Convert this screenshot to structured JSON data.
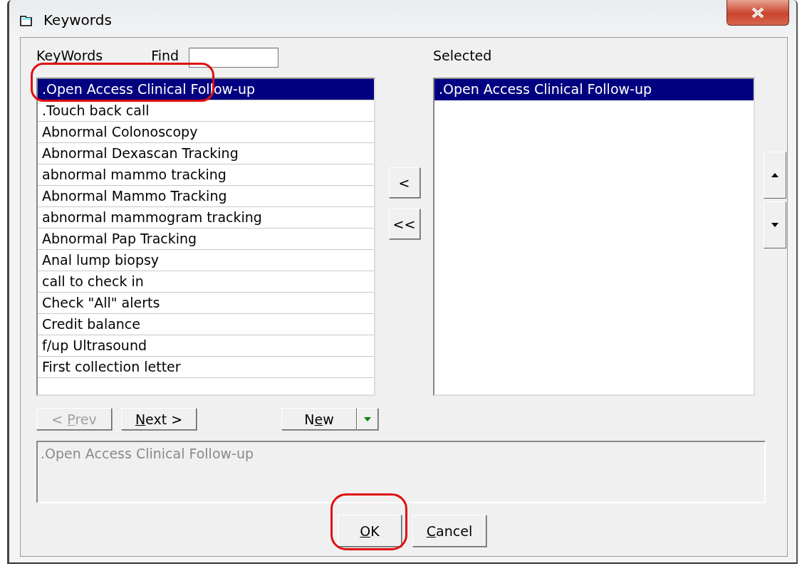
{
  "window": {
    "title": "Keywords"
  },
  "keywords": {
    "label": "KeyWords",
    "find_label": "Find",
    "items": [
      {
        "text": ".Open Access Clinical Follow-up",
        "selected": true,
        "circled": true
      },
      {
        "text": ".Touch back call",
        "selected": false,
        "circled": false
      },
      {
        "text": "Abnormal Colonoscopy",
        "selected": false,
        "circled": false
      },
      {
        "text": "Abnormal Dexascan Tracking",
        "selected": false,
        "circled": false
      },
      {
        "text": "abnormal mammo tracking",
        "selected": false,
        "circled": false
      },
      {
        "text": "Abnormal Mammo Tracking",
        "selected": false,
        "circled": false
      },
      {
        "text": "abnormal mammogram tracking",
        "selected": false,
        "circled": false
      },
      {
        "text": "Abnormal Pap Tracking",
        "selected": false,
        "circled": false
      },
      {
        "text": "Anal lump biopsy",
        "selected": false,
        "circled": false
      },
      {
        "text": "call to check in",
        "selected": false,
        "circled": false
      },
      {
        "text": "Check \"All\" alerts",
        "selected": false,
        "circled": false
      },
      {
        "text": "Credit balance",
        "selected": false,
        "circled": false
      },
      {
        "text": "f/up Ultrasound",
        "selected": false,
        "circled": false
      },
      {
        "text": "First collection letter",
        "selected": false,
        "circled": false
      }
    ]
  },
  "move_buttons": [
    "<",
    "<<"
  ],
  "selected": {
    "label": "Selected",
    "items": [
      {
        "text": ".Open Access Clinical Follow-up",
        "selected": true
      }
    ]
  },
  "nav_buttons": [
    {
      "label": "< Prev",
      "disabled": true
    },
    {
      "label": "Next >",
      "disabled": false
    }
  ],
  "new_button": {
    "label": "New"
  },
  "description": ".Open Access Clinical Follow-up",
  "dialog_buttons": [
    {
      "label": "OK",
      "circled": true
    },
    {
      "label": "Cancel",
      "circled": false
    }
  ]
}
